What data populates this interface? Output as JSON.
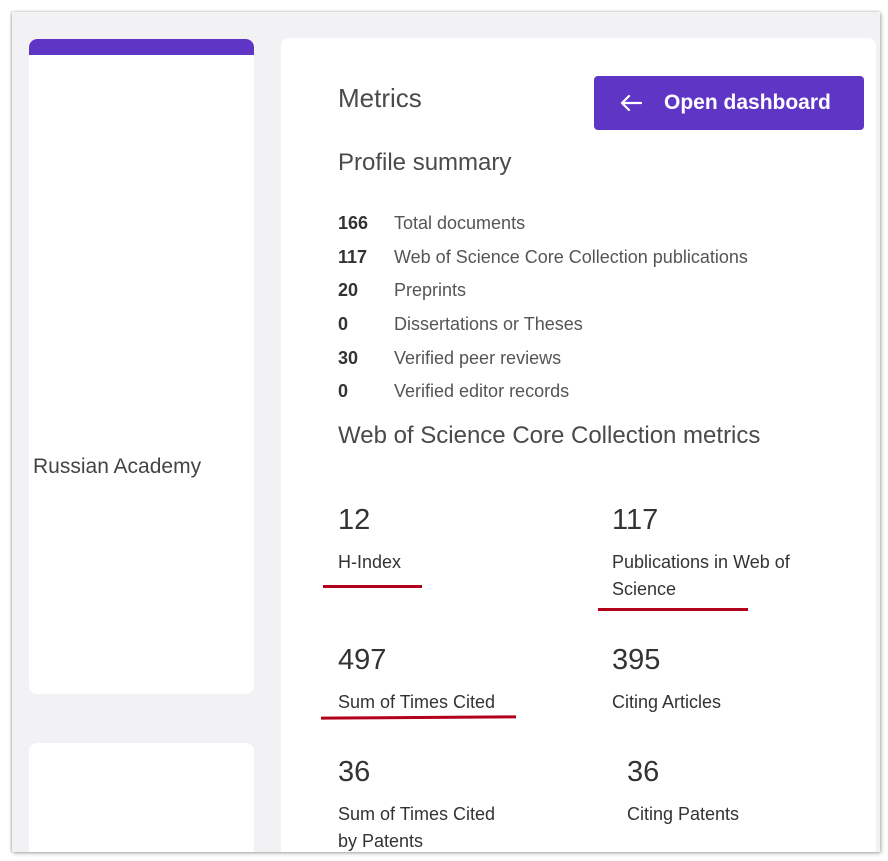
{
  "colors": {
    "accent": "#5e35c4",
    "annotation_underline": "#b3001b"
  },
  "left_panel": {
    "affiliation_text": "Russian Academy"
  },
  "metrics": {
    "title": "Metrics",
    "dashboard_button": {
      "label": "Open dashboard",
      "icon": "arrow-left-icon"
    },
    "profile_summary": {
      "heading": "Profile summary",
      "items": [
        {
          "count": "166",
          "label": "Total documents"
        },
        {
          "count": "117",
          "label": "Web of Science Core Collection publications"
        },
        {
          "count": "20",
          "label": "Preprints"
        },
        {
          "count": "0",
          "label": "Dissertations or Theses"
        },
        {
          "count": "30",
          "label": "Verified peer reviews"
        },
        {
          "count": "0",
          "label": "Verified editor records"
        }
      ]
    },
    "core_collection": {
      "heading": "Web of Science Core Collection metrics",
      "h_index": {
        "value": "12",
        "label": "H-Index"
      },
      "publications": {
        "value": "117",
        "label": "Publications in Web of Science"
      },
      "times_cited": {
        "value": "497",
        "label": "Sum of Times Cited"
      },
      "citing_articles": {
        "value": "395",
        "label": "Citing Articles"
      },
      "times_cited_patents": {
        "value": "36",
        "label": "Sum of Times Cited by Patents"
      },
      "citing_patents": {
        "value": "36",
        "label": "Citing Patents"
      }
    }
  }
}
